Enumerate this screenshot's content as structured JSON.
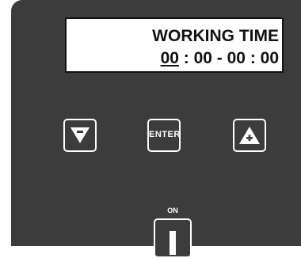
{
  "display": {
    "line1": "WORKING TIME",
    "line2_cursor": "00",
    "line2_rest": " : 00 - 00 : 00"
  },
  "buttons": {
    "down_icon": "down-triangle-minus-icon",
    "enter_label": "ENTER",
    "up_icon": "up-triangle-plus-icon"
  },
  "power": {
    "on_label": "ON",
    "icon": "power-bar-icon"
  },
  "colors": {
    "panel": "#3c3c3c",
    "display_bg": "#ffffff",
    "text": "#111111",
    "button_outline": "#ffffff"
  }
}
